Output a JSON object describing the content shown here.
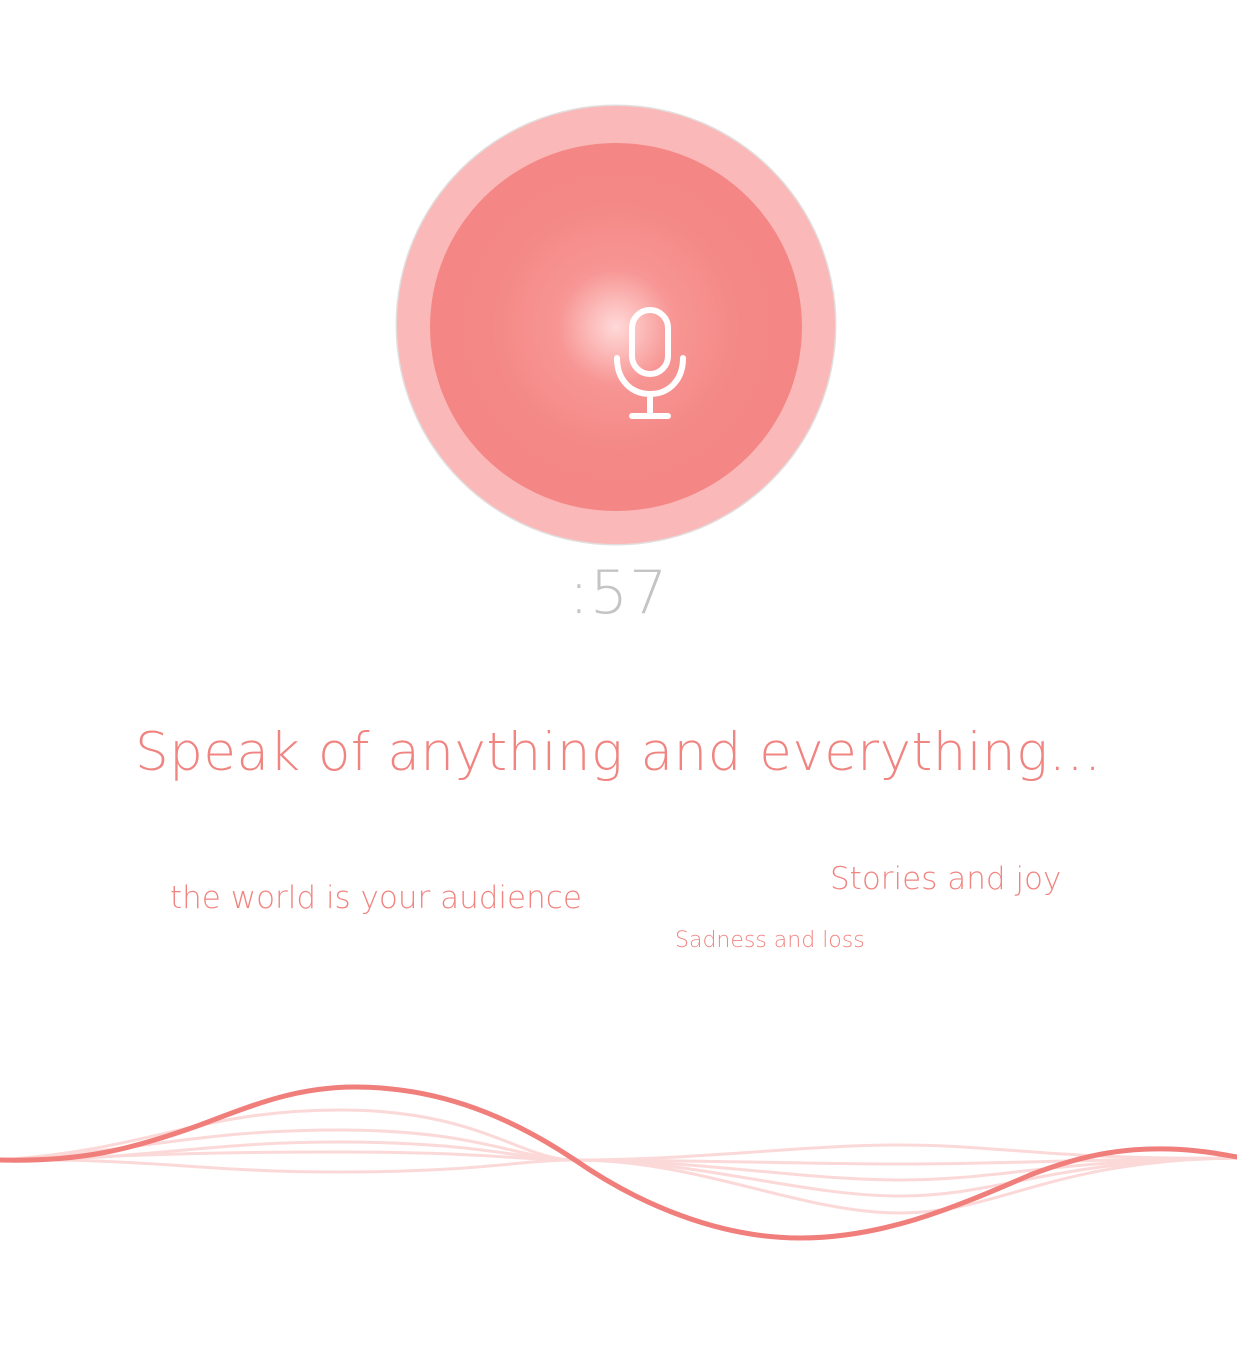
{
  "recorder": {
    "timer": ":57",
    "icon": "microphone-icon",
    "accent_color": "#f38583",
    "ring_color": "#fab8b8"
  },
  "prompt": {
    "headline": "Speak of anything and everything…"
  },
  "floating_phrases": [
    "the world is your audience",
    "Stories and joy",
    "Sadness and loss"
  ],
  "waveform": {
    "icon": "waveform-graphic",
    "color": "#f07e7b"
  }
}
